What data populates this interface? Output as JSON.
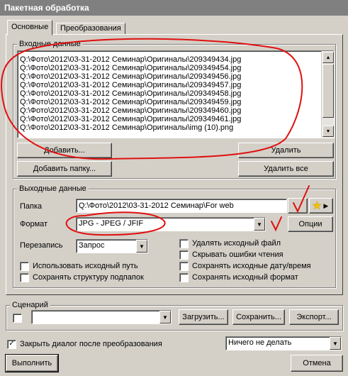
{
  "window": {
    "title": "Пакетная обработка"
  },
  "tabs": [
    {
      "label": "Основные"
    },
    {
      "label": "Преобразования"
    }
  ],
  "input": {
    "group_title": "Входные данные",
    "files": [
      "Q:\\Фото\\2012\\03-31-2012 Семинар\\Оригиналы\\209349434.jpg",
      "Q:\\Фото\\2012\\03-31-2012 Семинар\\Оригиналы\\209349454.jpg",
      "Q:\\Фото\\2012\\03-31-2012 Семинар\\Оригиналы\\209349456.jpg",
      "Q:\\Фото\\2012\\03-31-2012 Семинар\\Оригиналы\\209349457.jpg",
      "Q:\\Фото\\2012\\03-31-2012 Семинар\\Оригиналы\\209349458.jpg",
      "Q:\\Фото\\2012\\03-31-2012 Семинар\\Оригиналы\\209349459.jpg",
      "Q:\\Фото\\2012\\03-31-2012 Семинар\\Оригиналы\\209349460.jpg",
      "Q:\\Фото\\2012\\03-31-2012 Семинар\\Оригиналы\\209349461.jpg",
      "Q:\\Фото\\2012\\03-31-2012 Семинар\\Оригиналы\\img (10).png"
    ],
    "add_label": "Добавить...",
    "add_folder_label": "Добавить папку...",
    "delete_label": "Удалить",
    "delete_all_label": "Удалить все"
  },
  "output": {
    "group_title": "Выходные данные",
    "folder_label": "Папка",
    "folder_value": "Q:\\Фото\\2012\\03-31-2012 Семинар\\For web",
    "format_label": "Формат",
    "format_value": "JPG - JPEG / JFIF",
    "options_label": "Опции",
    "overwrite_label": "Перезапись",
    "overwrite_value": "Запрос",
    "checkboxes_left": [
      {
        "label": "Использовать исходный путь",
        "checked": false
      },
      {
        "label": "Сохранять структуру подпапок",
        "checked": false
      }
    ],
    "checkboxes_right": [
      {
        "label": "Удалять исходный файл",
        "checked": false
      },
      {
        "label": "Скрывать ошибки чтения",
        "checked": false
      },
      {
        "label": "Сохранять исходные дату/время",
        "checked": false
      },
      {
        "label": "Сохранять исходный формат",
        "checked": false
      }
    ]
  },
  "scenario": {
    "group_title": "Сценарий",
    "value": "",
    "load_label": "Загрузить...",
    "save_label": "Сохранить...",
    "export_label": "Экспорт..."
  },
  "footer": {
    "close_after_label": "Закрыть диалог после преобразования",
    "close_after_checked": true,
    "after_action_value": "Ничего не делать",
    "run_label": "Выполнить",
    "cancel_label": "Отмена"
  },
  "annotations": {
    "color": "#e01010"
  }
}
